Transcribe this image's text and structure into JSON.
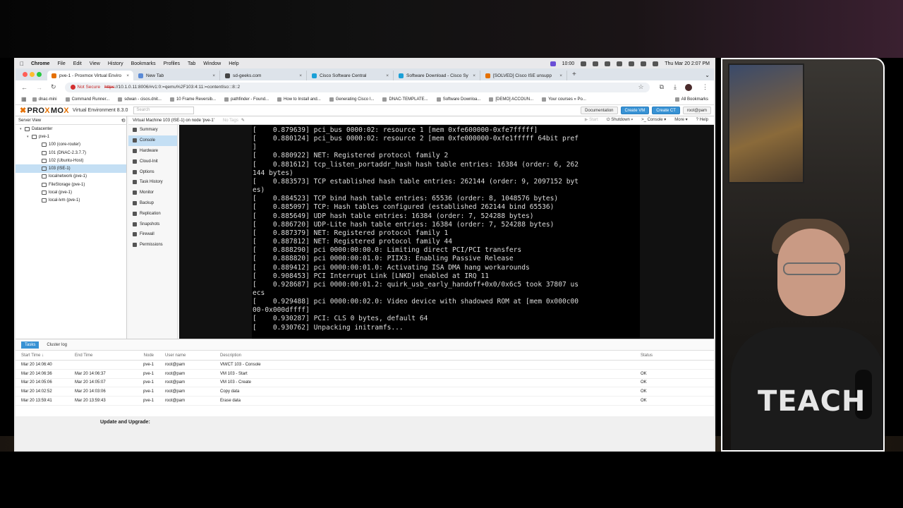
{
  "mac_menu": {
    "app": "Chrome",
    "items": [
      "File",
      "Edit",
      "View",
      "History",
      "Bookmarks",
      "Profiles",
      "Tab",
      "Window",
      "Help"
    ],
    "time": "10:00",
    "datetime": "Thu Mar 20 2:07 PM"
  },
  "tabs": [
    {
      "title": "pve-1 - Proxmox Virtual Enviro",
      "color": "#e57000",
      "active": true
    },
    {
      "title": "New Tab",
      "color": "#5a8ad6",
      "active": false
    },
    {
      "title": "sd-geeks.com",
      "color": "#444444",
      "active": false
    },
    {
      "title": "Cisco Software Central",
      "color": "#1ba0d7",
      "active": false
    },
    {
      "title": "Software Download - Cisco Sy",
      "color": "#1ba0d7",
      "active": false
    },
    {
      "title": "[SOLVED] Cisco ISE unsupp",
      "color": "#e57000",
      "active": false
    }
  ],
  "address": {
    "security": "Not Secure",
    "scheme": "https",
    "rest": "://10.1.0.11:8006/#v1:0:=qemu%2F103:4:11:=contentIso:::8::2"
  },
  "bookmarks": [
    "dnac-mini",
    "Command Runner...",
    "sdwan - cisos.dnit...",
    "10 Frame Reversib...",
    "pathfinder - Found...",
    "How to Install and...",
    "Generating Cisco I...",
    "DNAC-TEMPLATE...",
    "Software Downloa...",
    "[DEMO] ACCOUN...",
    "Your courses » Po..."
  ],
  "all_bookmarks": "All Bookmarks",
  "pve": {
    "logo_a": "PRO",
    "logo_b": "MO",
    "version": "Virtual Environment 8.3.0",
    "search_placeholder": "Search",
    "header_buttons": [
      {
        "label": "Documentation",
        "primary": false
      },
      {
        "label": "Create VM",
        "primary": true
      },
      {
        "label": "Create CT",
        "primary": true
      },
      {
        "label": "root@pam",
        "primary": false
      }
    ],
    "view_selector": "Server View",
    "tree": [
      {
        "label": "Datacenter",
        "indent": 6,
        "exp": "▾",
        "sel": false
      },
      {
        "label": "pve-1",
        "indent": 16,
        "exp": "▾",
        "sel": false
      },
      {
        "label": "100 (core-router)",
        "indent": 30,
        "exp": "",
        "sel": false
      },
      {
        "label": "101 (DNAC-2.3.7.7)",
        "indent": 30,
        "exp": "",
        "sel": false
      },
      {
        "label": "102 (Ubuntu-Host)",
        "indent": 30,
        "exp": "",
        "sel": false
      },
      {
        "label": "103 (ISE-1)",
        "indent": 30,
        "exp": "",
        "sel": true
      },
      {
        "label": "localnetwork (pve-1)",
        "indent": 30,
        "exp": "",
        "sel": false
      },
      {
        "label": "FileStorage (pve-1)",
        "indent": 30,
        "exp": "",
        "sel": false
      },
      {
        "label": "local (pve-1)",
        "indent": 30,
        "exp": "",
        "sel": false
      },
      {
        "label": "local-lvm (pve-1)",
        "indent": 30,
        "exp": "",
        "sel": false
      }
    ],
    "vm_title": "Virtual Machine 103 (ISE-1) on node 'pve-1'",
    "no_tags": "No Tags",
    "vm_actions": [
      {
        "label": "▶ Start",
        "dim": true
      },
      {
        "label": "⏻ Shutdown ▾",
        "dim": false
      },
      {
        "label": ">_ Console ▾",
        "dim": false
      },
      {
        "label": "More ▾",
        "dim": false
      },
      {
        "label": "? Help",
        "dim": false
      }
    ],
    "vm_menu": [
      {
        "label": "Summary",
        "sel": false
      },
      {
        "label": "Console",
        "sel": true
      },
      {
        "label": "Hardware",
        "sel": false
      },
      {
        "label": "Cloud-Init",
        "sel": false
      },
      {
        "label": "Options",
        "sel": false
      },
      {
        "label": "Task History",
        "sel": false
      },
      {
        "label": "Monitor",
        "sel": false
      },
      {
        "label": "Backup",
        "sel": false
      },
      {
        "label": "Replication",
        "sel": false
      },
      {
        "label": "Snapshots",
        "sel": false
      },
      {
        "label": "Firewall",
        "sel": false
      },
      {
        "label": "Permissions",
        "sel": false
      }
    ]
  },
  "console_lines": [
    "[    0.879639] pci_bus 0000:02: resource 1 [mem 0xfe600000-0xfe7fffff]",
    "[    0.880124] pci_bus 0000:02: resource 2 [mem 0xfe000000-0xfe1fffff 64bit pref",
    "]",
    "[    0.880922] NET: Registered protocol family 2",
    "[    0.881612] tcp_listen_portaddr_hash hash table entries: 16384 (order: 6, 262",
    "144 bytes)",
    "[    0.883573] TCP established hash table entries: 262144 (order: 9, 2097152 byt",
    "es)",
    "[    0.884523] TCP bind hash table entries: 65536 (order: 8, 1048576 bytes)",
    "[    0.885097] TCP: Hash tables configured (established 262144 bind 65536)",
    "[    0.885649] UDP hash table entries: 16384 (order: 7, 524288 bytes)",
    "[    0.886720] UDP-Lite hash table entries: 16384 (order: 7, 524288 bytes)",
    "[    0.887379] NET: Registered protocol family 1",
    "[    0.887812] NET: Registered protocol family 44",
    "[    0.888290] pci 0000:00:00.0: Limiting direct PCI/PCI transfers",
    "[    0.888820] pci 0000:00:01.0: PIIX3: Enabling Passive Release",
    "[    0.889412] pci 0000:00:01.0: Activating ISA DMA hang workarounds",
    "[    0.908453] PCI Interrupt Link [LNKD] enabled at IRQ 11",
    "[    0.928687] pci 0000:00:01.2: quirk_usb_early_handoff+0x0/0x6c5 took 37807 us",
    "ecs",
    "[    0.929488] pci 0000:00:02.0: Video device with shadowed ROM at [mem 0x000c00",
    "00-0x000dffff]",
    "[    0.930287] PCI: CLS 0 bytes, default 64",
    "[    0.930762] Unpacking initramfs..."
  ],
  "tasks": {
    "tabs": [
      "Tasks",
      "Cluster log"
    ],
    "headers": [
      "Start Time ↓",
      "End Time",
      "Node",
      "User name",
      "Description",
      "Status"
    ],
    "rows": [
      [
        "Mar 20 14:06:40",
        "",
        "pve-1",
        "root@pam",
        "VM/CT 103 - Console",
        ""
      ],
      [
        "Mar 20 14:06:36",
        "Mar 20 14:06:37",
        "pve-1",
        "root@pam",
        "VM 103 - Start",
        "OK"
      ],
      [
        "Mar 20 14:05:06",
        "Mar 20 14:05:07",
        "pve-1",
        "root@pam",
        "VM 103 - Create",
        "OK"
      ],
      [
        "Mar 20 14:02:52",
        "Mar 20 14:03:06",
        "pve-1",
        "root@pam",
        "Copy data",
        "OK"
      ],
      [
        "Mar 20 13:59:41",
        "Mar 20 13:59:43",
        "pve-1",
        "root@pam",
        "Erase data",
        "OK"
      ]
    ]
  },
  "update_label": "Update and Upgrade:",
  "webcam": {
    "shirt_text": "TEACH"
  }
}
